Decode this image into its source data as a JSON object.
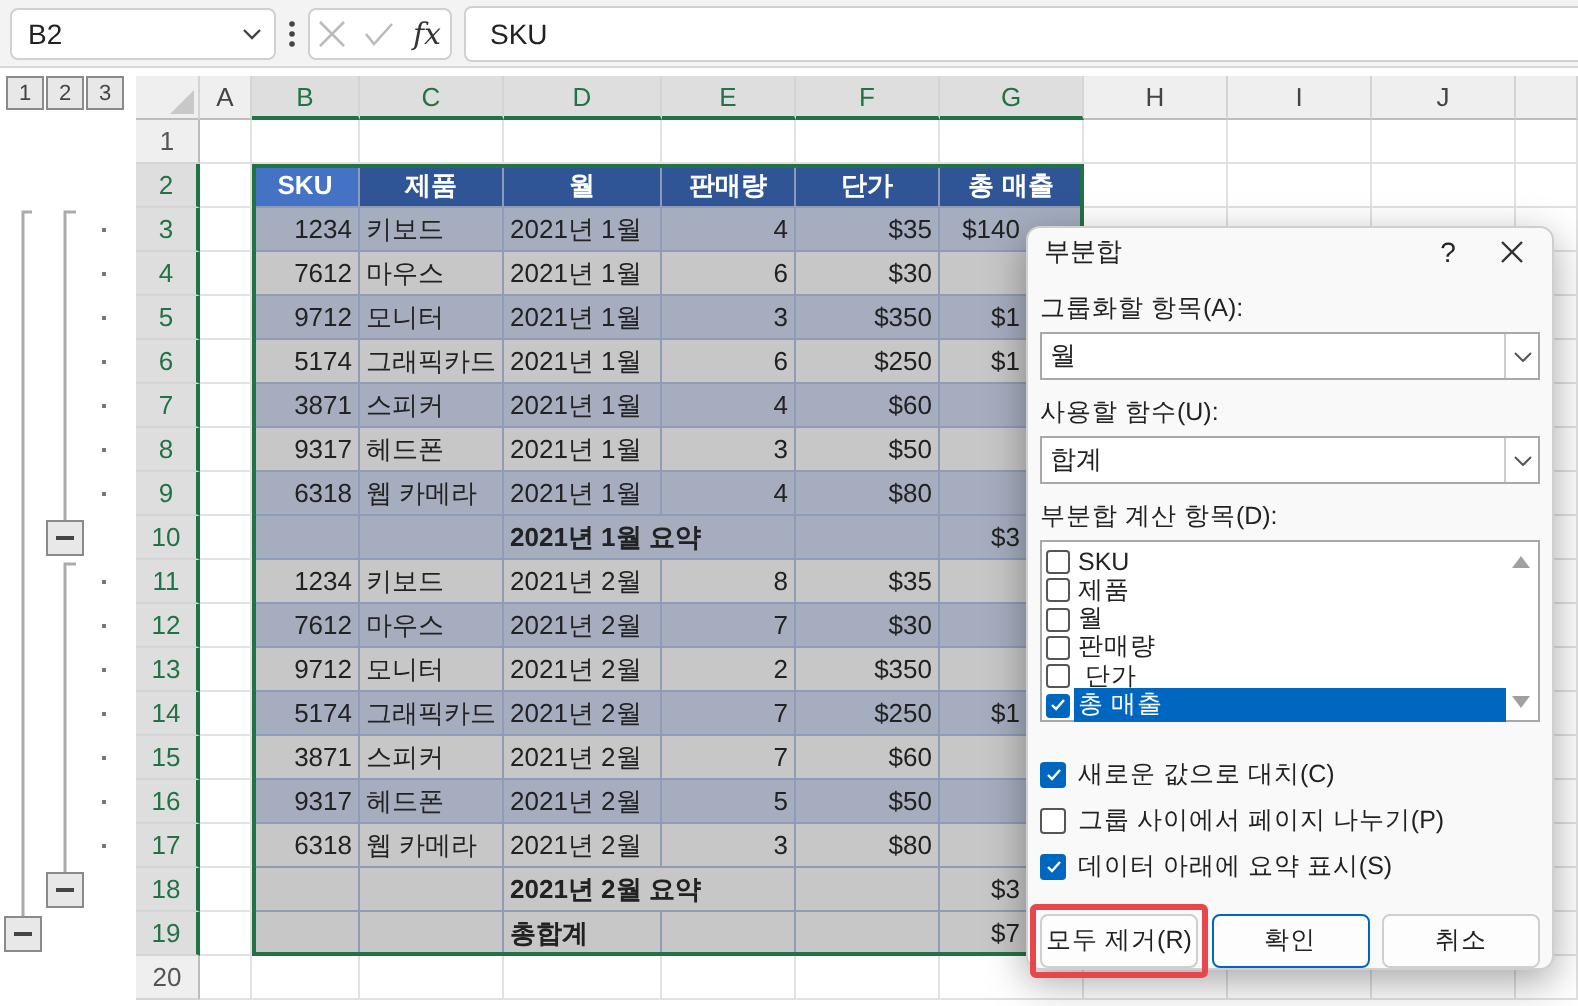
{
  "formula_bar": {
    "name_box": "B2",
    "function_label": "fx",
    "value": "SKU"
  },
  "outline": {
    "levels": [
      "1",
      "2",
      "3"
    ],
    "rows": [
      {
        "kind": "none"
      },
      {
        "kind": "none"
      },
      {
        "kind": "dot"
      },
      {
        "kind": "dot"
      },
      {
        "kind": "dot"
      },
      {
        "kind": "dot"
      },
      {
        "kind": "dot"
      },
      {
        "kind": "dot"
      },
      {
        "kind": "dot"
      },
      {
        "kind": "collapse_inner"
      },
      {
        "kind": "dot"
      },
      {
        "kind": "dot"
      },
      {
        "kind": "dot"
      },
      {
        "kind": "dot"
      },
      {
        "kind": "dot"
      },
      {
        "kind": "dot"
      },
      {
        "kind": "dot"
      },
      {
        "kind": "collapse_inner"
      },
      {
        "kind": "collapse_outer"
      },
      {
        "kind": "none"
      }
    ]
  },
  "sheet": {
    "columns": [
      "A",
      "B",
      "C",
      "D",
      "E",
      "F",
      "G",
      "H",
      "I",
      "J"
    ],
    "row_numbers": [
      "1",
      "2",
      "3",
      "4",
      "5",
      "6",
      "7",
      "8",
      "9",
      "10",
      "11",
      "12",
      "13",
      "14",
      "15",
      "16",
      "17",
      "18",
      "19",
      "20"
    ],
    "header": [
      {
        "label": "SKU",
        "active": true
      },
      {
        "label": "제품",
        "active": false
      },
      {
        "label": "월",
        "active": false
      },
      {
        "label": "판매량",
        "active": false
      },
      {
        "label": "단가",
        "active": false
      },
      {
        "label": "총 매출",
        "active": false
      }
    ],
    "rows": [
      {
        "kind": "detail",
        "banded": true,
        "cells": [
          "1234",
          "키보드",
          "2021년 1월",
          "4",
          "$35",
          "$140"
        ]
      },
      {
        "kind": "detail",
        "banded": false,
        "cells": [
          "7612",
          "마우스",
          "2021년 1월",
          "6",
          "$30"
        ]
      },
      {
        "kind": "detail",
        "banded": true,
        "cells": [
          "9712",
          "모니터",
          "2021년 1월",
          "3",
          "$350",
          "$1"
        ]
      },
      {
        "kind": "detail",
        "banded": false,
        "cells": [
          "5174",
          "그래픽카드",
          "2021년 1월",
          "6",
          "$250",
          "$1"
        ]
      },
      {
        "kind": "detail",
        "banded": true,
        "cells": [
          "3871",
          "스피커",
          "2021년 1월",
          "4",
          "$60"
        ]
      },
      {
        "kind": "detail",
        "banded": false,
        "cells": [
          "9317",
          "헤드폰",
          "2021년 1월",
          "3",
          "$50"
        ]
      },
      {
        "kind": "detail",
        "banded": true,
        "cells": [
          "6318",
          "웹 카메라",
          "2021년 1월",
          "4",
          "$80"
        ]
      },
      {
        "kind": "summary",
        "banded": true,
        "label": "2021년 1월 요약",
        "total": "$3"
      },
      {
        "kind": "detail",
        "banded": false,
        "cells": [
          "1234",
          "키보드",
          "2021년 2월",
          "8",
          "$35"
        ]
      },
      {
        "kind": "detail",
        "banded": true,
        "cells": [
          "7612",
          "마우스",
          "2021년 2월",
          "7",
          "$30"
        ]
      },
      {
        "kind": "detail",
        "banded": false,
        "cells": [
          "9712",
          "모니터",
          "2021년 2월",
          "2",
          "$350"
        ]
      },
      {
        "kind": "detail",
        "banded": true,
        "cells": [
          "5174",
          "그래픽카드",
          "2021년 2월",
          "7",
          "$250",
          "$1"
        ]
      },
      {
        "kind": "detail",
        "banded": false,
        "cells": [
          "3871",
          "스피커",
          "2021년 2월",
          "7",
          "$60"
        ]
      },
      {
        "kind": "detail",
        "banded": true,
        "cells": [
          "9317",
          "헤드폰",
          "2021년 2월",
          "5",
          "$50"
        ]
      },
      {
        "kind": "detail",
        "banded": false,
        "cells": [
          "6318",
          "웹 카메라",
          "2021년 2월",
          "3",
          "$80"
        ]
      },
      {
        "kind": "summary",
        "banded": false,
        "label": "2021년 2월 요약",
        "total": "$3"
      },
      {
        "kind": "grand_total",
        "banded": false,
        "label": "총합계",
        "total": "$7"
      }
    ]
  },
  "dialog": {
    "title": "부분합",
    "help": "?",
    "group_by": {
      "label": "그룹화할 항목(A):",
      "value": "월"
    },
    "function": {
      "label": "사용할 함수(U):",
      "value": "합계"
    },
    "fields_label": "부분합 계산 항목(D):",
    "fields": [
      {
        "label": "SKU",
        "checked": false,
        "selected": false
      },
      {
        "label": "제품",
        "checked": false,
        "selected": false
      },
      {
        "label": "월",
        "checked": false,
        "selected": false
      },
      {
        "label": "판매량",
        "checked": false,
        "selected": false
      },
      {
        "label": " 단가",
        "checked": false,
        "selected": false
      },
      {
        "label": "총 매출",
        "checked": true,
        "selected": true
      }
    ],
    "options": [
      {
        "label": "새로운 값으로 대치(C)",
        "checked": true
      },
      {
        "label": "그룹 사이에서 페이지 나누기(P)",
        "checked": false
      },
      {
        "label": "데이터 아래에 요약 표시(S)",
        "checked": true
      }
    ],
    "buttons": [
      {
        "label": "모두 제거(R)",
        "highlighted": true,
        "default": false
      },
      {
        "label": "확인",
        "highlighted": false,
        "default": true
      },
      {
        "label": "취소",
        "highlighted": false,
        "default": false
      }
    ]
  }
}
